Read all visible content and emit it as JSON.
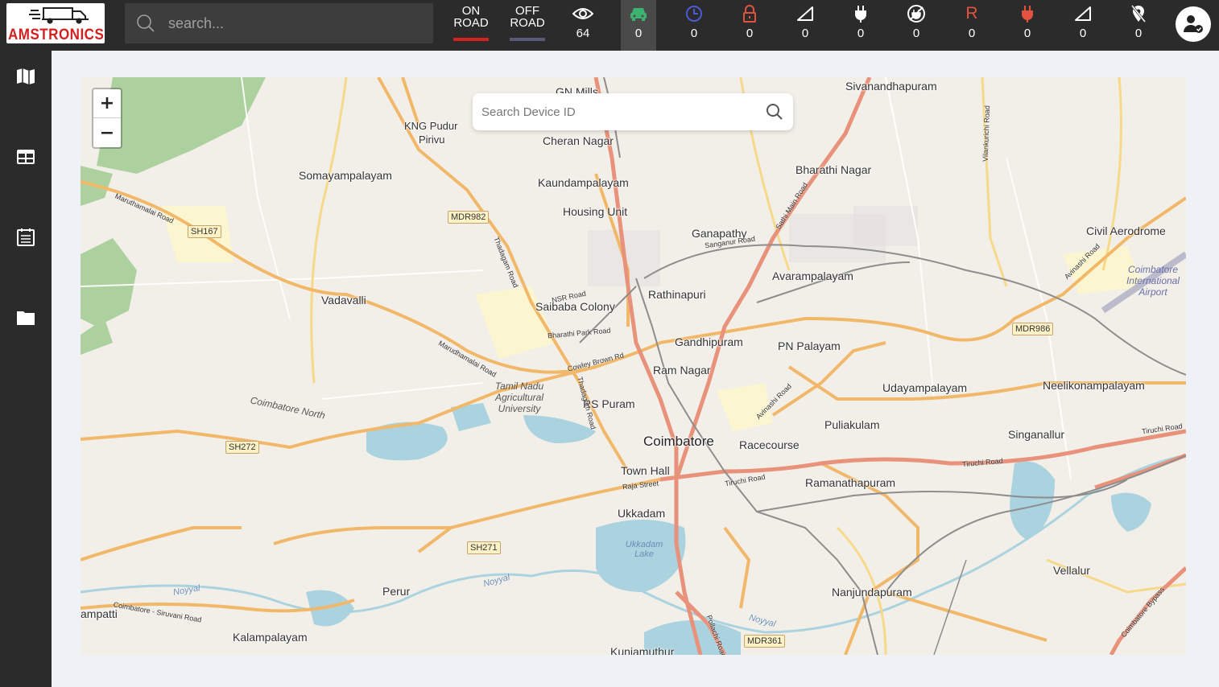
{
  "brand": {
    "name": "AMSTRONICS"
  },
  "search": {
    "placeholder": "search..."
  },
  "road_tabs": [
    {
      "label_line1": "ON",
      "label_line2": "ROAD",
      "indicator_color": "#d42020"
    },
    {
      "label_line1": "OFF",
      "label_line2": "ROAD",
      "indicator_color": "#5a5a78"
    }
  ],
  "status_counters": [
    {
      "icon": "eye-icon",
      "count": "64",
      "color": "#ffffff"
    },
    {
      "icon": "car-icon",
      "count": "0",
      "color": "#3cb371",
      "active": true
    },
    {
      "icon": "clock-icon",
      "count": "0",
      "color": "#4b5bd6"
    },
    {
      "icon": "lock-icon",
      "count": "0",
      "color": "#e2533f"
    },
    {
      "icon": "signal-icon",
      "count": "0",
      "color": "#ffffff"
    },
    {
      "icon": "plug-icon",
      "count": "0",
      "color": "#ffffff"
    },
    {
      "icon": "no-power-icon",
      "count": "0",
      "color": "#ffffff"
    },
    {
      "icon": "r-letter-icon",
      "count": "0",
      "color": "#e2533f",
      "letter": "R"
    },
    {
      "icon": "plug-red-icon",
      "count": "0",
      "color": "#e2533f"
    },
    {
      "icon": "signal-icon-2",
      "count": "0",
      "color": "#ffffff"
    },
    {
      "icon": "location-off-icon",
      "count": "0",
      "color": "#ffffff"
    }
  ],
  "sidebar": {
    "items": [
      {
        "icon": "map-icon"
      },
      {
        "icon": "table-icon"
      },
      {
        "icon": "report-icon"
      },
      {
        "icon": "folder-icon"
      }
    ]
  },
  "map": {
    "zoom_in": "+",
    "zoom_out": "−",
    "device_search_placeholder": "Search Device ID",
    "places": [
      {
        "text": "GN Mills",
        "cls": ""
      },
      {
        "text": "Sivanandhapuram",
        "cls": ""
      },
      {
        "text": "KNG Pudur",
        "cls": ""
      },
      {
        "text": "Pirivu",
        "cls": ""
      },
      {
        "text": "Cheran Nagar",
        "cls": ""
      },
      {
        "text": "Somayampalayam",
        "cls": ""
      },
      {
        "text": "Bharathi Nagar",
        "cls": ""
      },
      {
        "text": "Kaundampalayam",
        "cls": ""
      },
      {
        "text": "Housing Unit",
        "cls": ""
      },
      {
        "text": "Ganapathy",
        "cls": ""
      },
      {
        "text": "Civil Aerodrome",
        "cls": ""
      },
      {
        "text": "Avarampalayam",
        "cls": ""
      },
      {
        "text": "Rathinapuri",
        "cls": ""
      },
      {
        "text": "Vadavalli",
        "cls": ""
      },
      {
        "text": "Saibaba Colony",
        "cls": ""
      },
      {
        "text": "Gandhipuram",
        "cls": ""
      },
      {
        "text": "PN Palayam",
        "cls": ""
      },
      {
        "text": "Ram Nagar",
        "cls": ""
      },
      {
        "text": "Udayampalayam",
        "cls": ""
      },
      {
        "text": "Neelikonampalayam",
        "cls": ""
      },
      {
        "text": "RS Puram",
        "cls": ""
      },
      {
        "text": "Puliakulam",
        "cls": ""
      },
      {
        "text": "Coimbatore",
        "cls": "big"
      },
      {
        "text": "Racecourse",
        "cls": ""
      },
      {
        "text": "Singanallur",
        "cls": ""
      },
      {
        "text": "Town Hall",
        "cls": ""
      },
      {
        "text": "Ramanathapuram",
        "cls": ""
      },
      {
        "text": "Ukkadam",
        "cls": ""
      },
      {
        "text": "Vellalur",
        "cls": ""
      },
      {
        "text": "Perur",
        "cls": ""
      },
      {
        "text": "Nanjundapuram",
        "cls": ""
      },
      {
        "text": "Kalampalayam",
        "cls": ""
      },
      {
        "text": "Kuniamuthur",
        "cls": ""
      },
      {
        "text": "ampatti",
        "cls": ""
      }
    ],
    "shields": [
      "MDR982",
      "SH167",
      "MDR986",
      "SH272",
      "SH271",
      "MDR361"
    ],
    "road_labels": [
      "Maruthamalai Road",
      "Thadagam Road",
      "NSR Road",
      "Bharathi Park Road",
      "Cowley Brown Rd",
      "Marudhamalai Road",
      "Thadagam Road",
      "Sathi Main Road",
      "Sanganur Road",
      "Avinashi Road",
      "Avinashi Road",
      "Tiruchi Road",
      "Tiruchi Road",
      "Tiruchi Road",
      "Raja Street",
      "Coimbatore - Siruvani Road",
      "Pollachi Road",
      "Vilankurichi Road",
      "Coimbatore Bypass",
      "Noyyal",
      "Noyyal",
      "Noyyal"
    ],
    "tnau": "Tamil Nadu Agricultural University",
    "coimbatore_north": "Coimbatore North",
    "airport": "Coimbatore International Airport",
    "ukkadam_lake": "Ukkadam Lake"
  }
}
